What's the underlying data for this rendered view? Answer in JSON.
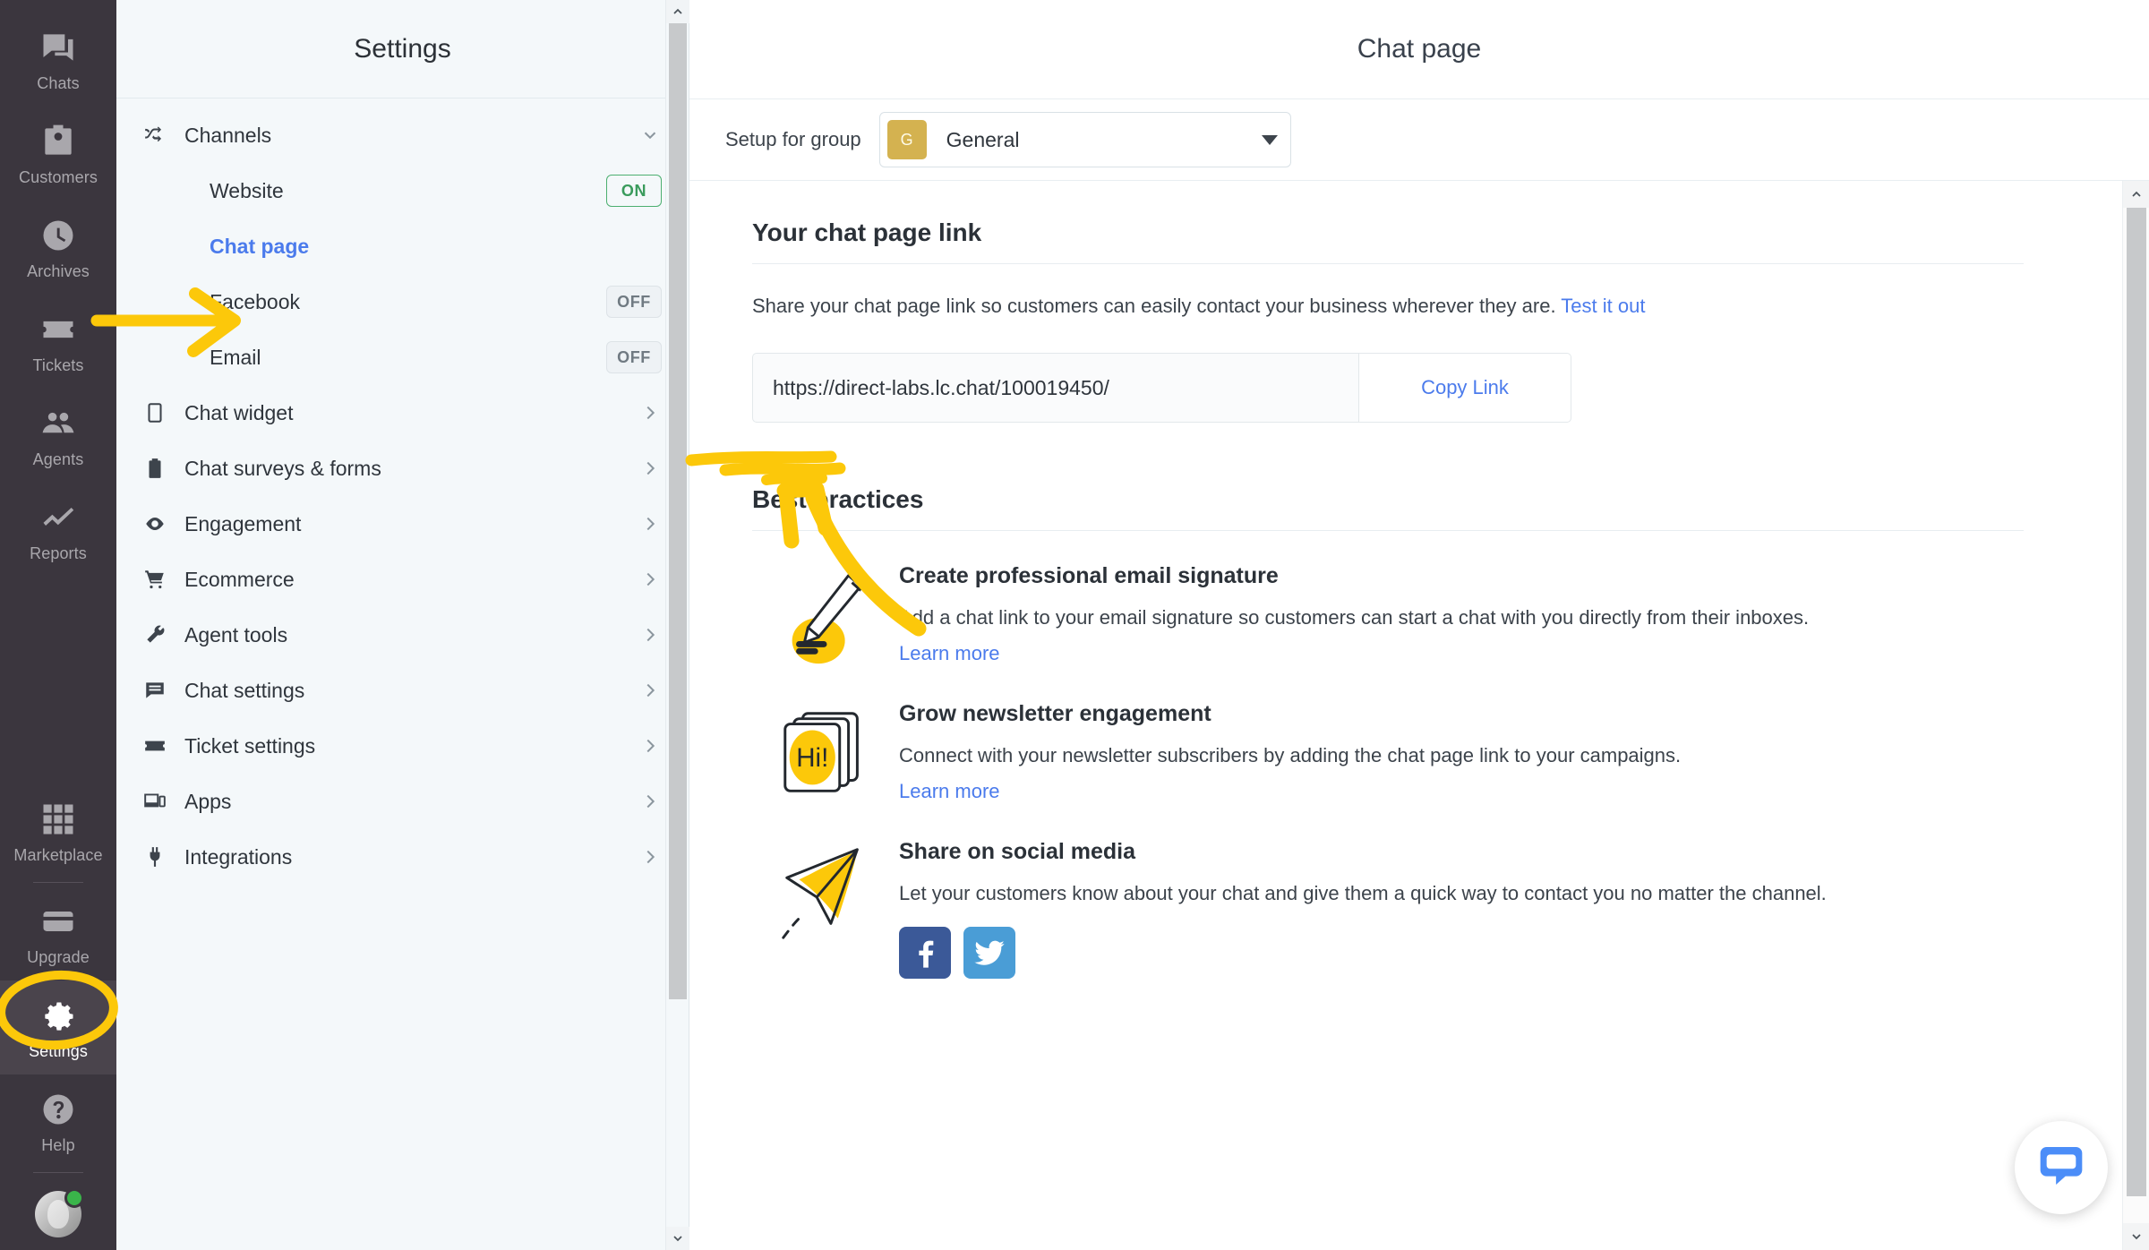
{
  "colors": {
    "accent_blue": "#4b7bec",
    "annotation_yellow": "#fcc80a",
    "rail_bg": "#3b363e",
    "sidebar_bg": "#f4f8fa",
    "group_avatar": "#d4b250",
    "status_green": "#3ab44a",
    "facebook": "#3b5998",
    "twitter": "#4a9dd6"
  },
  "rail": {
    "items": [
      {
        "label": "Chats",
        "icon": "chats-icon",
        "active": false
      },
      {
        "label": "Customers",
        "icon": "customers-icon",
        "active": false
      },
      {
        "label": "Archives",
        "icon": "archives-clock-icon",
        "active": false
      },
      {
        "label": "Tickets",
        "icon": "tickets-icon",
        "active": false
      },
      {
        "label": "Agents",
        "icon": "agents-icon",
        "active": false
      },
      {
        "label": "Reports",
        "icon": "reports-chart-icon",
        "active": false
      }
    ],
    "bottom_items": [
      {
        "label": "Marketplace",
        "icon": "marketplace-grid-icon",
        "active": false
      },
      {
        "label": "Upgrade",
        "icon": "upgrade-card-icon",
        "active": false
      },
      {
        "label": "Settings",
        "icon": "gear-icon",
        "active": true
      },
      {
        "label": "Help",
        "icon": "help-question-icon",
        "active": false
      }
    ]
  },
  "sidebar": {
    "title": "Settings",
    "groups": [
      {
        "label": "Channels",
        "icon": "channels-icon",
        "type": "group",
        "state": "expanded"
      },
      {
        "label": "Website",
        "type": "sub",
        "badge": "ON",
        "badge_state": "on"
      },
      {
        "label": "Chat page",
        "type": "sub",
        "selected": true
      },
      {
        "label": "Facebook",
        "type": "sub",
        "badge": "OFF",
        "badge_state": "off"
      },
      {
        "label": "Email",
        "type": "sub",
        "badge": "OFF",
        "badge_state": "off"
      },
      {
        "label": "Chat widget",
        "icon": "widget-icon",
        "type": "group"
      },
      {
        "label": "Chat surveys & forms",
        "icon": "clipboard-icon",
        "type": "group"
      },
      {
        "label": "Engagement",
        "icon": "eye-icon",
        "type": "group"
      },
      {
        "label": "Ecommerce",
        "icon": "cart-icon",
        "type": "group"
      },
      {
        "label": "Agent tools",
        "icon": "wrench-icon",
        "type": "group"
      },
      {
        "label": "Chat settings",
        "icon": "chat-lines-icon",
        "type": "group"
      },
      {
        "label": "Ticket settings",
        "icon": "ticket-icon",
        "type": "group"
      },
      {
        "label": "Apps",
        "icon": "apps-monitor-icon",
        "type": "group"
      },
      {
        "label": "Integrations",
        "icon": "plug-icon",
        "type": "group"
      }
    ]
  },
  "main": {
    "title": "Chat page",
    "group_bar": {
      "label": "Setup for group",
      "avatar_initial": "G",
      "selected_group": "General"
    },
    "link_section": {
      "heading": "Your chat page link",
      "description": "Share your chat page link so customers can easily contact your business wherever they are.",
      "test_link_label": "Test it out",
      "url": "https://direct-labs.lc.chat/100019450/",
      "copy_button_label": "Copy Link"
    },
    "best_practices": {
      "heading": "Best practices",
      "items": [
        {
          "icon": "pencil-signature-icon",
          "title": "Create professional email signature",
          "body": "Add a chat link to your email signature so customers can start a chat with you directly from their inboxes.",
          "learn_more": "Learn more"
        },
        {
          "icon": "newsletter-cards-icon",
          "title": "Grow newsletter engagement",
          "body": "Connect with your newsletter subscribers by adding the chat page link to your campaigns.",
          "learn_more": "Learn more"
        },
        {
          "icon": "paper-plane-icon",
          "title": "Share on social media",
          "body": "Let your customers know about your chat and give them a quick way to contact you no matter the channel.",
          "socials": [
            "facebook-icon",
            "twitter-icon"
          ]
        }
      ]
    }
  },
  "chat_widget": {
    "icon": "chat-bubble-icon"
  },
  "annotations": [
    {
      "type": "arrow",
      "target": "sidebar-item-chat-page",
      "color": "#fcc80a"
    },
    {
      "type": "ellipse",
      "target": "rail-item-settings",
      "color": "#fcc80a"
    },
    {
      "type": "underline-scribble",
      "target": "chat-page-url",
      "color": "#fcc80a"
    },
    {
      "type": "curved-arrow",
      "target": "chat-page-url",
      "color": "#fcc80a"
    }
  ]
}
